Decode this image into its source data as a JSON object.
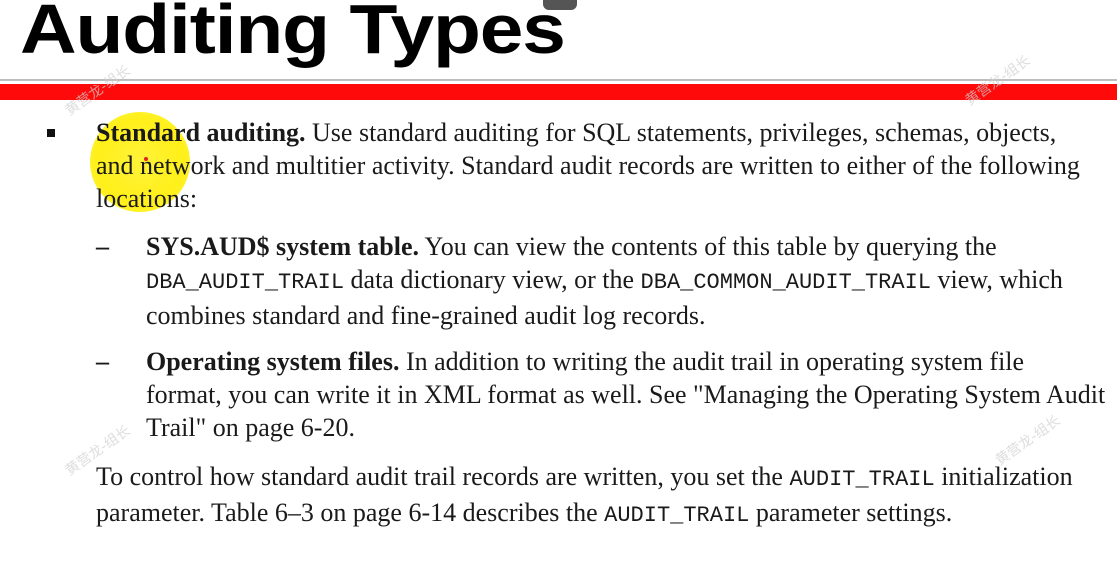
{
  "title": "Auditing Types",
  "watermark": "黄营龙-组长",
  "bullet1": {
    "lead": "Standard auditing.",
    "text": " Use standard auditing for SQL statements, privileges, schemas, objects, and network and multitier activity. Standard audit records are written to either of the following locations:"
  },
  "sub1": {
    "lead": "SYS.AUD$ system table.",
    "t1": " You can view the contents of this table by querying the ",
    "code1": "DBA_AUDIT_TRAIL",
    "t2": " data dictionary view, or the ",
    "code2": "DBA_COMMON_AUDIT_TRAIL",
    "t3": " view, which combines standard and fine-grained audit log records."
  },
  "sub2": {
    "lead": "Operating system files.",
    "text": " In addition to writing the audit trail in operating system file format, you can write it in XML format as well. See \"Managing the Operating System Audit Trail\" on page 6-20."
  },
  "closing": {
    "t1": "To control how standard audit trail records are written, you set the ",
    "code1": "AUDIT_TRAIL",
    "t2": " initialization parameter. Table 6–3 on page 6-14 describes the ",
    "code2": "AUDIT_TRAIL",
    "t3": " parameter settings."
  },
  "dash": "–",
  "colors": {
    "accent_bar": "#ff0a0a",
    "highlight": "#fff33a"
  }
}
